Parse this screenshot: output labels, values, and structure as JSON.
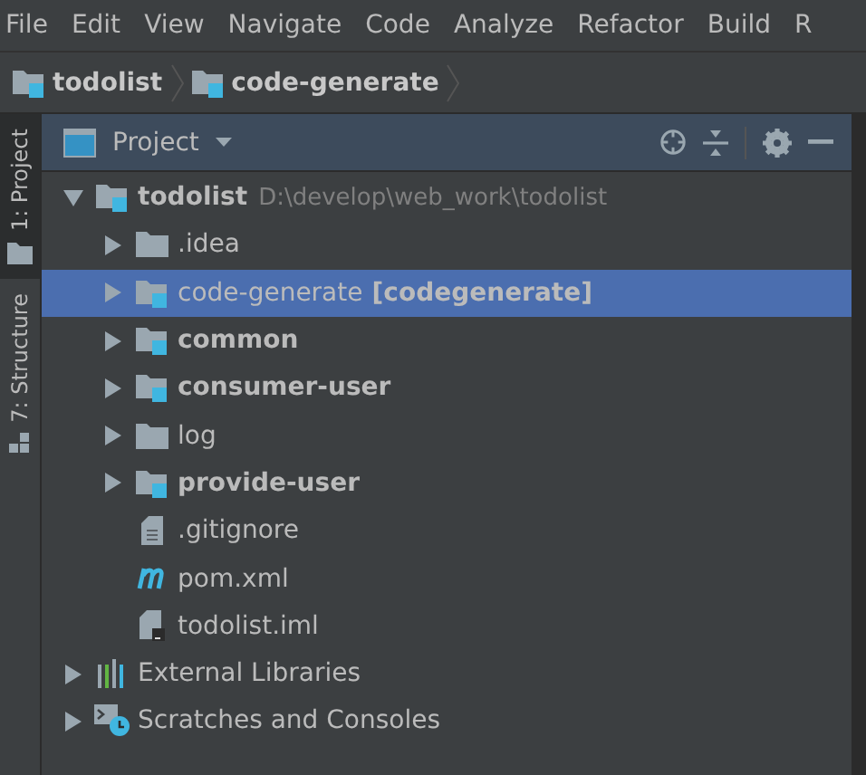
{
  "menu": [
    {
      "label": "File"
    },
    {
      "label": "Edit"
    },
    {
      "label": "View"
    },
    {
      "label": "Navigate"
    },
    {
      "label": "Code"
    },
    {
      "label": "Analyze"
    },
    {
      "label": "Refactor"
    },
    {
      "label": "Build"
    },
    {
      "label": "R"
    }
  ],
  "breadcrumb": [
    {
      "label": "todolist"
    },
    {
      "label": "code-generate"
    }
  ],
  "side_tabs": [
    {
      "label": "1: Project",
      "selected": true
    },
    {
      "label": "7: Structure",
      "selected": false
    }
  ],
  "panel": {
    "title": "Project"
  },
  "tree": [
    {
      "label": "todolist",
      "kind": "module",
      "bold": true,
      "path": "D:\\develop\\web_work\\todolist",
      "expanded": true,
      "selected": false,
      "children": [
        {
          "label": ".idea",
          "kind": "folder",
          "bold": false,
          "expanded": false,
          "selected": false
        },
        {
          "label": "code-generate",
          "kind": "module",
          "bold": false,
          "module_name": "[codegenerate]",
          "expanded": false,
          "selected": true
        },
        {
          "label": "common",
          "kind": "module",
          "bold": true,
          "expanded": false,
          "selected": false
        },
        {
          "label": "consumer-user",
          "kind": "module",
          "bold": true,
          "expanded": false,
          "selected": false
        },
        {
          "label": "log",
          "kind": "folder",
          "bold": false,
          "expanded": false,
          "selected": false
        },
        {
          "label": "provide-user",
          "kind": "module",
          "bold": true,
          "expanded": false,
          "selected": false
        },
        {
          "label": ".gitignore",
          "kind": "file",
          "bold": false,
          "selected": false
        },
        {
          "label": "pom.xml",
          "kind": "maven",
          "bold": false,
          "selected": false
        },
        {
          "label": "todolist.iml",
          "kind": "iml",
          "bold": false,
          "selected": false
        }
      ]
    },
    {
      "label": "External Libraries",
      "kind": "libraries",
      "bold": false,
      "expanded": false,
      "selected": false
    },
    {
      "label": "Scratches and Consoles",
      "kind": "scratches",
      "bold": false,
      "expanded": false,
      "selected": false
    }
  ]
}
